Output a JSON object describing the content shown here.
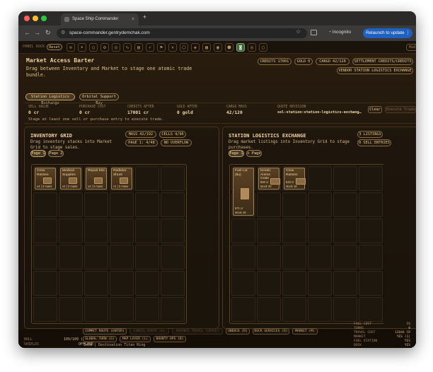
{
  "browser": {
    "tab_title": "Space Ship Commander",
    "url": "space-commander.gentrydemchak.com",
    "incognito_label": "Incognito",
    "relaunch_label": "Relaunch to update"
  },
  "dock": {
    "label": "PANEL DOCK",
    "reset_label": "Reset",
    "icons": [
      "hammer-icon",
      "cursor-icon",
      "circle-icon",
      "gear-icon",
      "clock-icon",
      "wave-icon",
      "chart-icon",
      "rocket-icon",
      "tool-icon",
      "cross-icon",
      "shield-icon",
      "cube-icon",
      "grid-icon",
      "map-icon",
      "cargo-icon",
      "station-icon",
      "target-icon",
      "frame-icon"
    ],
    "right_label": "Hid"
  },
  "header": {
    "title": "Market Access Barter",
    "subtitle": "Drag between Inventory and Market to stage one atomic trade bundle.",
    "tabs": [
      "Station Logistics Exchange",
      "Orbital Support Bay"
    ],
    "badges": [
      "CREDITS 17001",
      "GOLD 0",
      "CARGO 42/120",
      "SETTLEMENT CREDITS/CREDITS"
    ],
    "vendor": "VENDOR STATION LOGISTICS EXCHANGE"
  },
  "stats": {
    "sell_label": "SELL VALUE",
    "sell_value": "0 cr",
    "purchase_label": "PURCHASE COST",
    "purchase_value": "0 cr",
    "credits_after_label": "CREDITS AFTER",
    "credits_after_value": "17001 cr",
    "gold_after_label": "GOLD AFTER",
    "gold_after_value": "0 gold",
    "cargo_label": "CARGO MASS",
    "cargo_value": "42/120",
    "quote_label": "QUOTE REVISION",
    "quote_value": "sol-station:station-logistics-exchang…",
    "clear_label": "Clear",
    "execute_label": "Execute Trade",
    "hint": "Stage at least one sell or purchase entry to execute trade."
  },
  "inventory": {
    "title": "INVENTORY GRID",
    "subtitle": "Drag inventory stacks into Market Grid to stage sales.",
    "badges": [
      "MASS 42/192",
      "CELLS 4/96",
      "PAGE 1: 4/48",
      "NO OVERFLOW"
    ],
    "pages": [
      "Page 1",
      "Page 2"
    ],
    "items": [
      {
        "name": "Crew Rations",
        "meta": "x4 | 3 mass"
      },
      {
        "name": "Medical Supplies",
        "meta": "x2 | 2 mass"
      },
      {
        "name": "Repair Kits",
        "meta": "x2 | 2 mass"
      },
      {
        "name": "Radiator Shunt",
        "meta": "x1 | 2 mass"
      }
    ]
  },
  "market": {
    "title": "STATION LOGISTICS EXCHANGE",
    "subtitle": "Drag market listings into Inventory Grid to stage purchases.",
    "badges": [
      "3 LISTINGS",
      "0 SELL ENTRIES"
    ],
    "page_label": "Page 1",
    "add_page_label": "+ Page",
    "listings": [
      {
        "name": "Fuel Lot (8u)",
        "price": "671 cr",
        "stock": "stock 16"
      },
      {
        "name": "Kinetic Ammo Crate",
        "price": "550 cr",
        "stock": "stock 20"
      },
      {
        "name": "Crew Rations",
        "price": "533 cr",
        "stock": "stock 18"
      }
    ]
  },
  "bottom": {
    "hull_label": "HULL",
    "hull_value": "109/109 (100%)",
    "shields_label": "SHIELDS",
    "shields_value": "OFFLINE",
    "buttons_row1": [
      "COMMIT ROUTE (ENTER)",
      "CANCEL ROUTE (X)",
      "ADVANCE TRAVEL (SPACE)",
      "UNDOCK (D)",
      "DOCK SERVICES (O)",
      "MARKET (M)"
    ],
    "buttons_row2": [
      "GLOBAL TURN (G)",
      "MAP LAYER (L)",
      "BOUNTY OPS (B)"
    ],
    "status": "Idle | Destination Titan Ring",
    "readouts": [
      {
        "label": "FUEL COST",
        "value": "CS"
      },
      {
        "label": "TURNS",
        "value": "0"
      },
      {
        "label": "TRAVEL COST",
        "value": "12046 CR"
      },
      {
        "label": "MARKET",
        "value": "YES (1)"
      },
      {
        "label": "FUEL STATION",
        "value": "YES"
      },
      {
        "label": "DOCK",
        "value": "YES"
      }
    ]
  }
}
